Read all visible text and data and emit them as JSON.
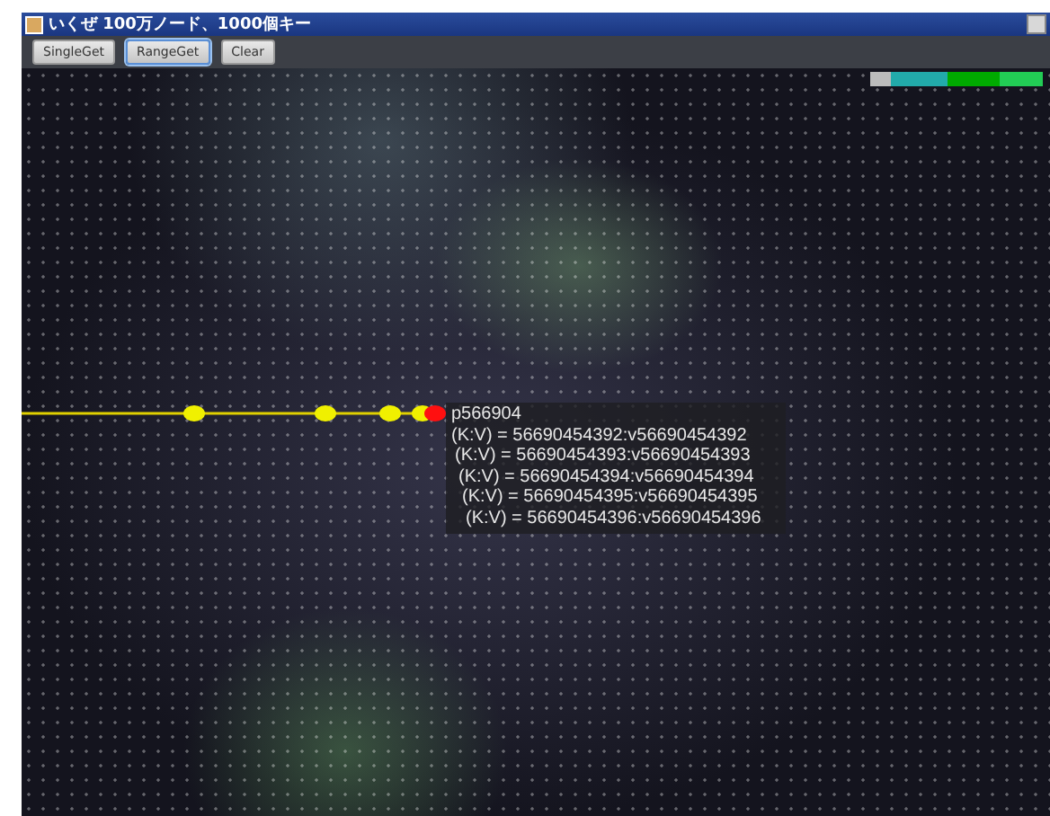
{
  "window": {
    "title": "いくぜ 100万ノード、1000個キー"
  },
  "toolbar": {
    "buttons": [
      {
        "label": "SingleGet",
        "focused": false
      },
      {
        "label": "RangeGet",
        "focused": true
      },
      {
        "label": "Clear",
        "focused": false
      }
    ]
  },
  "graph": {
    "nodes": [
      {
        "selected": false
      },
      {
        "selected": false
      },
      {
        "selected": false
      },
      {
        "selected": false
      },
      {
        "selected": true
      }
    ]
  },
  "tooltip": {
    "title": "p566904",
    "lines": [
      "(K:V) = 56690454392:v56690454392",
      "(K:V) = 56690454393:v56690454393",
      "(K:V) = 56690454394:v56690454394",
      "(K:V) = 56690454395:v56690454395",
      "(K:V) = 56690454396:v56690454396"
    ]
  }
}
